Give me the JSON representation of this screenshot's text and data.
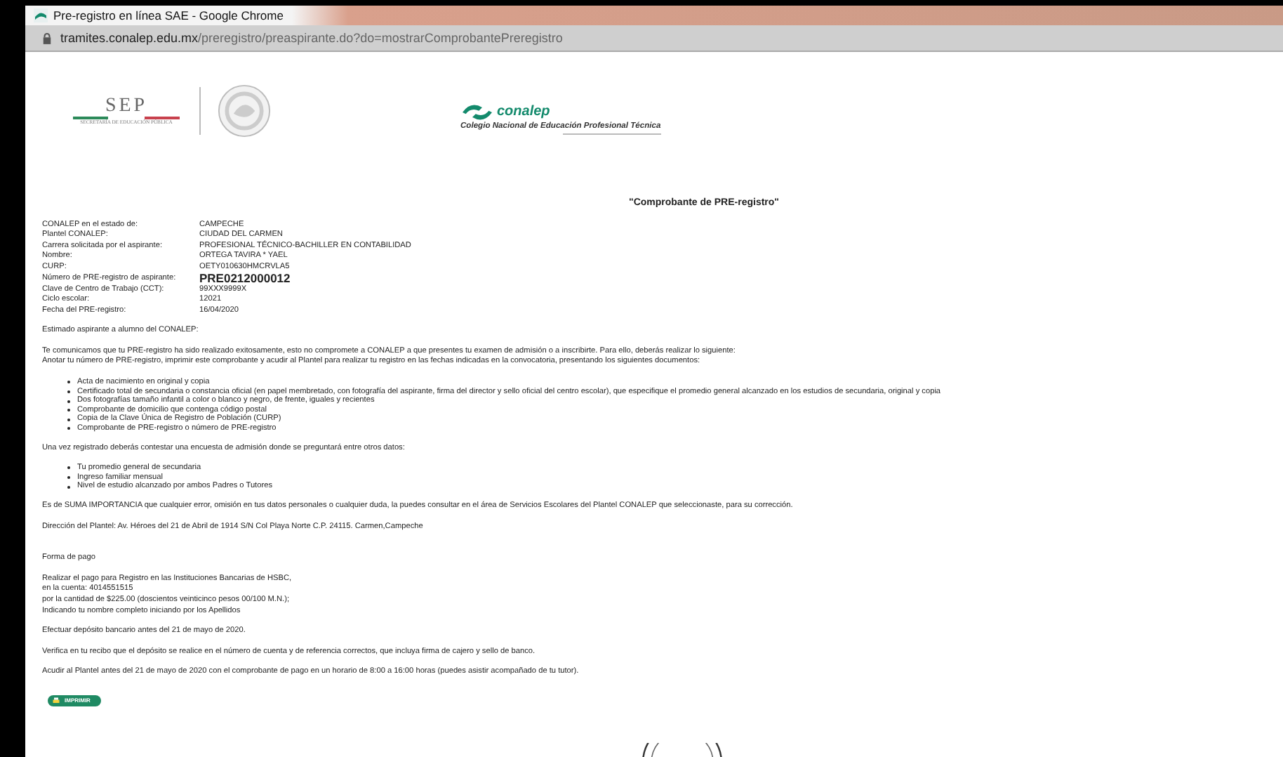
{
  "window": {
    "title": "Pre-registro en línea SAE - Google Chrome"
  },
  "address_bar": {
    "url_host": "tramites.conalep.edu.mx",
    "url_path": "/preregistro/preaspirante.do?do=mostrarComprobantePreregistro"
  },
  "header": {
    "sep_logo": "SEP",
    "sep_subtitle": "SECRETARÍA DE EDUCACIÓN PÚBLICA",
    "conalep_logo": "conalep",
    "conalep_subtitle": "Colegio Nacional de Educación Profesional Técnica"
  },
  "document_title": "\"Comprobante de PRE-registro\"",
  "fields": [
    {
      "label": "CONALEP en el estado de:",
      "value": "CAMPECHE",
      "kind": "plain"
    },
    {
      "label": "Plantel CONALEP:",
      "value": "CIUDAD DEL CARMEN",
      "kind": "plain"
    },
    {
      "label": "Carrera solicitada por el aspirante:",
      "value": "PROFESIONAL TÉCNICO-BACHILLER EN CONTABILIDAD",
      "kind": "plain"
    },
    {
      "label": "Nombre:",
      "value": "ORTEGA TAVIRA * YAEL",
      "kind": "plain"
    },
    {
      "label": "CURP:",
      "value": "OETY010630HMCRVLA5",
      "kind": "plain"
    },
    {
      "label": "Número de PRE-registro de aspirante:",
      "value": "PRE0212000012",
      "kind": "emphasis"
    },
    {
      "label": "Clave de Centro de Trabajo (CCT):",
      "value": "99XXX9999X",
      "kind": "plain"
    },
    {
      "label": "Ciclo escolar:",
      "value": "12021",
      "kind": "plain"
    },
    {
      "label": "Fecha del PRE-registro:",
      "value": "16/04/2020",
      "kind": "plain"
    }
  ],
  "blocks": [
    {
      "kind": "paragraph",
      "lines": [
        "Estimado aspirante a alumno del CONALEP:"
      ]
    },
    {
      "kind": "paragraph",
      "lines": [
        "Te comunicamos que tu PRE-registro ha sido realizado exitosamente, esto no compromete a CONALEP a que presentes tu examen de admisión o a inscribirte. Para ello, deberás realizar lo siguiente:",
        "Anotar tu número de PRE-registro, imprimir este comprobante y acudir al Plantel para realizar tu registro en las fechas indicadas en la convocatoria, presentando los siguientes documentos:"
      ]
    },
    {
      "kind": "list",
      "lines": [
        "Acta de nacimiento en original y copia",
        "Certificado total de secundaria o constancia oficial (en papel membretado, con fotografía del aspirante, firma del director y sello oficial del centro escolar), que especifique el promedio general alcanzado en los estudios de secundaria, original y copia",
        "Dos fotografías tamaño infantil a color o blanco y negro, de frente, iguales y recientes",
        "Comprobante de domicilio que contenga código postal",
        "Copia de la Clave Única de Registro de Población (CURP)",
        "Comprobante de PRE-registro o número de PRE-registro"
      ]
    },
    {
      "kind": "paragraph",
      "lines": [
        "Una vez registrado deberás contestar una encuesta de admisión donde se preguntará entre otros datos:"
      ]
    },
    {
      "kind": "list",
      "lines": [
        "Tu promedio general de secundaria",
        "Ingreso familiar mensual",
        "Nivel de estudio alcanzado por ambos Padres o Tutores"
      ]
    },
    {
      "kind": "paragraph",
      "lines": [
        "Es de SUMA IMPORTANCIA que cualquier error, omisión en tus datos personales o cualquier duda, la puedes consultar en el área de Servicios Escolares del Plantel CONALEP que seleccionaste, para su corrección."
      ]
    },
    {
      "kind": "paragraph",
      "lines": [
        "Dirección del Plantel:  Av. Héroes del 21 de Abril de 1914 S/N Col Playa Norte C.P. 24115. Carmen,Campeche"
      ]
    },
    {
      "kind": "spacer"
    },
    {
      "kind": "paragraph",
      "lines": [
        "Forma de pago"
      ]
    },
    {
      "kind": "paragraph",
      "lines": [
        "Realizar el pago para Registro en las Instituciones Bancarias de HSBC,",
        "en la cuenta: 4014551515",
        "por la cantidad de $225.00 (doscientos veinticinco pesos 00/100 M.N.);",
        "Indicando tu nombre completo iniciando por los Apellidos"
      ]
    },
    {
      "kind": "paragraph",
      "lines": [
        "Efectuar depósito bancario antes del 21 de mayo de 2020."
      ]
    },
    {
      "kind": "paragraph",
      "lines": [
        "Verifica en tu recibo que el depósito se realice en el número de cuenta y de referencia correctos, que incluya firma de cajero y sello de banco."
      ]
    },
    {
      "kind": "paragraph",
      "lines": [
        "Acudir al Plantel antes del 21 de mayo de 2020 con el comprobante de pago en un horario de 8:00 a 16:00 horas (puedes asistir acompañado de tu tutor)."
      ]
    }
  ],
  "print_button": {
    "label": "IMPRIMIR"
  }
}
